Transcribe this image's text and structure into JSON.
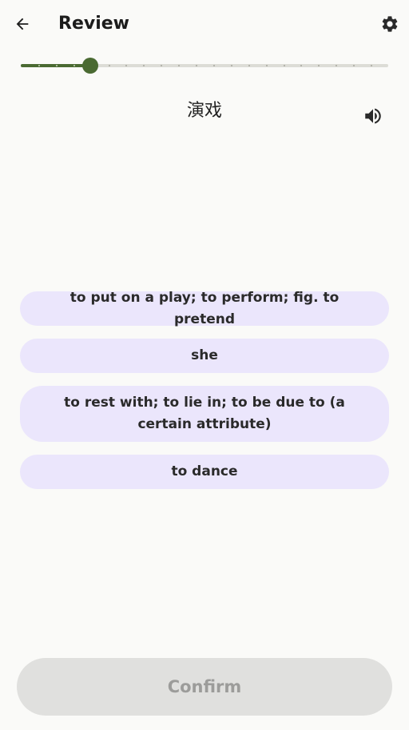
{
  "header": {
    "title": "Review",
    "back_icon": "arrow-left-icon",
    "settings_icon": "gear-icon"
  },
  "progress": {
    "current": 4,
    "total": 18,
    "fraction": 0.19,
    "accent": "#4a6a32"
  },
  "question": {
    "word": "演戏",
    "audio_icon": "speaker-icon"
  },
  "options": [
    "to put on a play; to perform; fig. to pretend",
    "she",
    "to rest with; to lie in; to be due to (a certain attribute)",
    "to dance"
  ],
  "colors": {
    "option_bg": "#ebe6fc",
    "confirm_bg": "#e0e0de",
    "confirm_text": "#9c9c9a"
  },
  "footer": {
    "confirm_label": "Confirm"
  }
}
